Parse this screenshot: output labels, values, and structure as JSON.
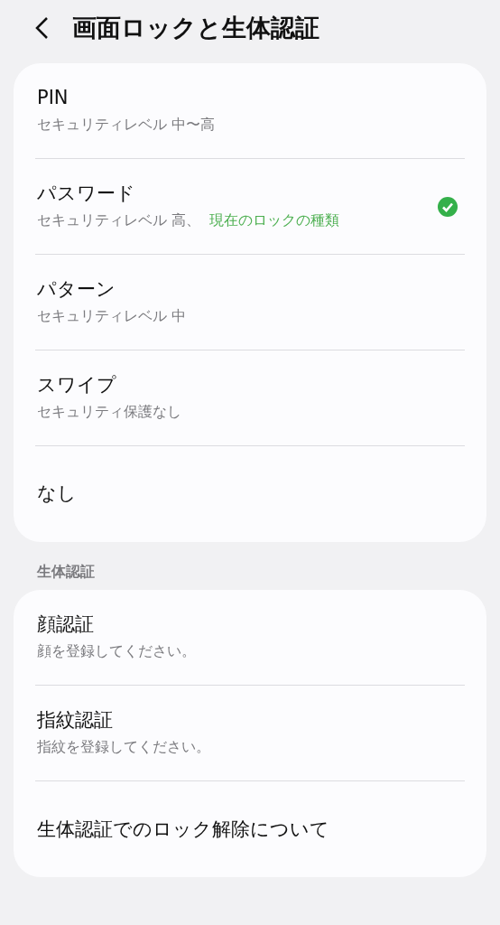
{
  "header": {
    "title": "画面ロックと生体認証"
  },
  "lock_types": [
    {
      "title": "PIN",
      "subtitle": "セキュリティレベル 中〜高",
      "selected": false
    },
    {
      "title": "パスワード",
      "subtitle": "セキュリティレベル 高、",
      "status": "現在のロックの種類",
      "selected": true
    },
    {
      "title": "パターン",
      "subtitle": "セキュリティレベル 中",
      "selected": false
    },
    {
      "title": "スワイプ",
      "subtitle": "セキュリティ保護なし",
      "selected": false
    },
    {
      "title": "なし",
      "selected": false
    }
  ],
  "biometrics": {
    "heading": "生体認証",
    "items": [
      {
        "title": "顔認証",
        "subtitle": "顔を登録してください。"
      },
      {
        "title": "指紋認証",
        "subtitle": "指紋を登録してください。"
      },
      {
        "title": "生体認証でのロック解除について"
      }
    ]
  }
}
